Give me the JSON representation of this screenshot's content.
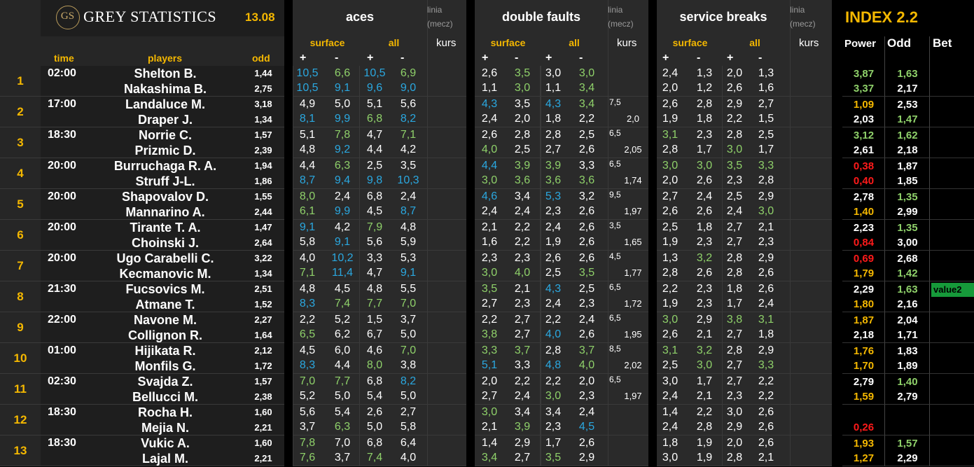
{
  "brand": {
    "logo_mono": "GS",
    "name": "GREY STATISTICS",
    "date": "13.08"
  },
  "headers": {
    "aces": "aces",
    "double_faults": "double faults",
    "service_breaks": "service breaks",
    "linia": "linia",
    "mecz": "(mecz)",
    "kurs": "kurs",
    "surface": "surface",
    "all": "all",
    "plus": "+",
    "minus": "-",
    "time": "time",
    "players": "players",
    "odd": "odd",
    "index": "INDEX 2.2",
    "power": "Power",
    "odd2": "Odd",
    "bet": "Bet"
  },
  "colors": {
    "white": "#ffffff",
    "blue": "#2aa8e0",
    "green": "#8fd16a",
    "yellow": "#f5b800",
    "red": "#ff1a1a",
    "bet_bg": "#169a3a"
  },
  "matches": [
    {
      "num": "1",
      "time": "02:00",
      "p1": "Shelton B.",
      "p2": "Nakashima B.",
      "o1": "1,44",
      "o2": "2,75",
      "aces": [
        [
          "10,5",
          "b",
          "6,6",
          "g",
          "10,5",
          "b",
          "6,9",
          "g"
        ],
        [
          "10,5",
          "b",
          "9,1",
          "b",
          "9,6",
          "b",
          "9,0",
          "b"
        ]
      ],
      "df": [
        [
          "2,6",
          "w",
          "3,5",
          "g",
          "3,0",
          "w",
          "3,0",
          "g"
        ],
        [
          "1,1",
          "w",
          "3,0",
          "g",
          "1,1",
          "w",
          "3,4",
          "g"
        ]
      ],
      "kl": "",
      "kv": "",
      "sb": [
        [
          "2,4",
          "w",
          "1,3",
          "w",
          "2,0",
          "w",
          "1,3",
          "w"
        ],
        [
          "2,0",
          "w",
          "1,2",
          "w",
          "2,6",
          "w",
          "1,6",
          "w"
        ]
      ],
      "pw": [
        [
          "3,87",
          "g"
        ],
        [
          "3,37",
          "g"
        ]
      ],
      "io": [
        [
          "1,63",
          "g"
        ],
        [
          "2,17",
          "w"
        ]
      ],
      "bet": ""
    },
    {
      "num": "2",
      "time": "17:00",
      "p1": "Landaluce M.",
      "p2": "Draper J.",
      "o1": "3,18",
      "o2": "1,34",
      "aces": [
        [
          "4,9",
          "w",
          "5,0",
          "w",
          "5,1",
          "w",
          "5,6",
          "w"
        ],
        [
          "8,1",
          "b",
          "9,9",
          "b",
          "6,8",
          "g",
          "8,2",
          "b"
        ]
      ],
      "df": [
        [
          "4,3",
          "b",
          "3,5",
          "w",
          "4,3",
          "b",
          "3,4",
          "g"
        ],
        [
          "2,4",
          "w",
          "2,0",
          "w",
          "1,8",
          "w",
          "2,2",
          "w"
        ]
      ],
      "kl": "7,5",
      "kv": "2,0",
      "sb": [
        [
          "2,6",
          "w",
          "2,8",
          "w",
          "2,9",
          "w",
          "2,7",
          "w"
        ],
        [
          "1,9",
          "w",
          "1,8",
          "w",
          "2,2",
          "w",
          "1,5",
          "w"
        ]
      ],
      "pw": [
        [
          "1,09",
          "y"
        ],
        [
          "2,03",
          "w"
        ]
      ],
      "io": [
        [
          "2,53",
          "w"
        ],
        [
          "1,47",
          "g"
        ]
      ],
      "bet": ""
    },
    {
      "num": "3",
      "time": "18:30",
      "p1": "Norrie C.",
      "p2": "Prizmic D.",
      "o1": "1,57",
      "o2": "2,39",
      "aces": [
        [
          "5,1",
          "w",
          "7,8",
          "g",
          "4,7",
          "w",
          "7,1",
          "g"
        ],
        [
          "4,8",
          "w",
          "9,2",
          "b",
          "4,4",
          "w",
          "4,2",
          "w"
        ]
      ],
      "df": [
        [
          "2,6",
          "w",
          "2,8",
          "w",
          "2,8",
          "w",
          "2,5",
          "w"
        ],
        [
          "4,0",
          "g",
          "2,5",
          "w",
          "2,7",
          "w",
          "2,6",
          "w"
        ]
      ],
      "kl": "6,5",
      "kv": "2,05",
      "sb": [
        [
          "3,1",
          "g",
          "2,3",
          "w",
          "2,8",
          "w",
          "2,5",
          "w"
        ],
        [
          "2,8",
          "w",
          "1,7",
          "w",
          "3,0",
          "g",
          "1,7",
          "w"
        ]
      ],
      "pw": [
        [
          "3,12",
          "g"
        ],
        [
          "2,61",
          "w"
        ]
      ],
      "io": [
        [
          "1,62",
          "g"
        ],
        [
          "2,18",
          "w"
        ]
      ],
      "bet": ""
    },
    {
      "num": "4",
      "time": "20:00",
      "p1": "Burruchaga R. A.",
      "p2": "Struff J-L.",
      "o1": "1,94",
      "o2": "1,86",
      "aces": [
        [
          "4,4",
          "w",
          "6,3",
          "g",
          "2,5",
          "w",
          "3,5",
          "w"
        ],
        [
          "8,7",
          "b",
          "9,4",
          "b",
          "9,8",
          "b",
          "10,3",
          "b"
        ]
      ],
      "df": [
        [
          "4,4",
          "b",
          "3,9",
          "g",
          "3,9",
          "g",
          "3,3",
          "w"
        ],
        [
          "3,0",
          "g",
          "3,6",
          "g",
          "3,6",
          "g",
          "3,6",
          "g"
        ]
      ],
      "kl": "6,5",
      "kv": "1,74",
      "sb": [
        [
          "3,0",
          "g",
          "3,0",
          "g",
          "3,5",
          "g",
          "3,3",
          "g"
        ],
        [
          "2,0",
          "w",
          "2,6",
          "w",
          "2,3",
          "w",
          "2,8",
          "w"
        ]
      ],
      "pw": [
        [
          "0,38",
          "r"
        ],
        [
          "0,40",
          "r"
        ]
      ],
      "io": [
        [
          "1,87",
          "w"
        ],
        [
          "1,85",
          "w"
        ]
      ],
      "bet": ""
    },
    {
      "num": "5",
      "time": "20:00",
      "p1": "Shapovalov D.",
      "p2": "Mannarino A.",
      "o1": "1,55",
      "o2": "2,44",
      "aces": [
        [
          "8,0",
          "g",
          "2,4",
          "w",
          "6,8",
          "w",
          "2,4",
          "w"
        ],
        [
          "6,1",
          "g",
          "9,9",
          "b",
          "4,5",
          "w",
          "8,7",
          "b"
        ]
      ],
      "df": [
        [
          "4,6",
          "b",
          "3,4",
          "w",
          "5,3",
          "b",
          "3,2",
          "w"
        ],
        [
          "2,4",
          "w",
          "2,4",
          "w",
          "2,3",
          "w",
          "2,6",
          "w"
        ]
      ],
      "kl": "9,5",
      "kv": "1,97",
      "sb": [
        [
          "2,7",
          "w",
          "2,4",
          "w",
          "2,5",
          "w",
          "2,9",
          "w"
        ],
        [
          "2,6",
          "w",
          "2,6",
          "w",
          "2,4",
          "w",
          "3,0",
          "g"
        ]
      ],
      "pw": [
        [
          "2,78",
          "w"
        ],
        [
          "1,40",
          "y"
        ]
      ],
      "io": [
        [
          "1,35",
          "g"
        ],
        [
          "2,99",
          "w"
        ]
      ],
      "bet": ""
    },
    {
      "num": "6",
      "time": "20:00",
      "p1": "Tirante T. A.",
      "p2": "Choinski J.",
      "o1": "1,47",
      "o2": "2,64",
      "aces": [
        [
          "9,1",
          "b",
          "4,2",
          "w",
          "7,9",
          "g",
          "4,8",
          "w"
        ],
        [
          "5,8",
          "w",
          "9,1",
          "b",
          "5,6",
          "w",
          "5,9",
          "w"
        ]
      ],
      "df": [
        [
          "2,1",
          "w",
          "2,2",
          "w",
          "2,4",
          "w",
          "2,6",
          "w"
        ],
        [
          "1,6",
          "w",
          "2,2",
          "w",
          "1,9",
          "w",
          "2,6",
          "w"
        ]
      ],
      "kl": "3,5",
      "kv": "1,65",
      "sb": [
        [
          "2,5",
          "w",
          "1,8",
          "w",
          "2,7",
          "w",
          "2,1",
          "w"
        ],
        [
          "1,9",
          "w",
          "2,3",
          "w",
          "2,7",
          "w",
          "2,3",
          "w"
        ]
      ],
      "pw": [
        [
          "2,23",
          "w"
        ],
        [
          "0,84",
          "r"
        ]
      ],
      "io": [
        [
          "1,35",
          "g"
        ],
        [
          "3,00",
          "w"
        ]
      ],
      "bet": ""
    },
    {
      "num": "7",
      "time": "20:00",
      "p1": "Ugo Carabelli C.",
      "p2": "Kecmanovic M.",
      "o1": "3,22",
      "o2": "1,34",
      "aces": [
        [
          "4,0",
          "w",
          "10,2",
          "b",
          "3,3",
          "w",
          "5,3",
          "w"
        ],
        [
          "7,1",
          "g",
          "11,4",
          "b",
          "4,7",
          "w",
          "9,1",
          "b"
        ]
      ],
      "df": [
        [
          "2,3",
          "w",
          "2,3",
          "w",
          "2,6",
          "w",
          "2,6",
          "w"
        ],
        [
          "3,0",
          "g",
          "4,0",
          "g",
          "2,5",
          "w",
          "3,5",
          "g"
        ]
      ],
      "kl": "4,5",
      "kv": "1,77",
      "sb": [
        [
          "1,3",
          "w",
          "3,2",
          "g",
          "2,8",
          "w",
          "2,9",
          "w"
        ],
        [
          "2,8",
          "w",
          "2,6",
          "w",
          "2,8",
          "w",
          "2,6",
          "w"
        ]
      ],
      "pw": [
        [
          "0,69",
          "r"
        ],
        [
          "1,79",
          "y"
        ]
      ],
      "io": [
        [
          "2,68",
          "w"
        ],
        [
          "1,42",
          "g"
        ]
      ],
      "bet": ""
    },
    {
      "num": "8",
      "time": "21:30",
      "p1": "Fucsovics M.",
      "p2": "Atmane T.",
      "o1": "2,51",
      "o2": "1,52",
      "aces": [
        [
          "4,8",
          "w",
          "4,5",
          "w",
          "4,8",
          "w",
          "5,5",
          "w"
        ],
        [
          "8,3",
          "b",
          "7,4",
          "g",
          "7,7",
          "g",
          "7,0",
          "g"
        ]
      ],
      "df": [
        [
          "3,5",
          "g",
          "2,1",
          "w",
          "4,3",
          "b",
          "2,5",
          "w"
        ],
        [
          "2,7",
          "w",
          "2,3",
          "w",
          "2,4",
          "w",
          "2,3",
          "w"
        ]
      ],
      "kl": "6,5",
      "kv": "1,72",
      "sb": [
        [
          "2,2",
          "w",
          "2,3",
          "w",
          "1,8",
          "w",
          "2,6",
          "w"
        ],
        [
          "1,9",
          "w",
          "2,3",
          "w",
          "1,7",
          "w",
          "2,4",
          "w"
        ]
      ],
      "pw": [
        [
          "2,29",
          "w"
        ],
        [
          "1,80",
          "y"
        ]
      ],
      "io": [
        [
          "1,63",
          "g"
        ],
        [
          "2,16",
          "w"
        ]
      ],
      "bet": "value2"
    },
    {
      "num": "9",
      "time": "22:00",
      "p1": "Navone M.",
      "p2": "Collignon R.",
      "o1": "2,27",
      "o2": "1,64",
      "aces": [
        [
          "2,2",
          "w",
          "5,2",
          "w",
          "1,5",
          "w",
          "3,7",
          "w"
        ],
        [
          "6,5",
          "g",
          "6,2",
          "w",
          "6,7",
          "w",
          "5,0",
          "w"
        ]
      ],
      "df": [
        [
          "2,2",
          "w",
          "2,7",
          "w",
          "2,2",
          "w",
          "2,4",
          "w"
        ],
        [
          "3,8",
          "g",
          "2,7",
          "w",
          "4,0",
          "b",
          "2,6",
          "w"
        ]
      ],
      "kl": "6,5",
      "kv": "1,95",
      "sb": [
        [
          "3,0",
          "g",
          "2,9",
          "w",
          "3,8",
          "g",
          "3,1",
          "g"
        ],
        [
          "2,6",
          "w",
          "2,1",
          "w",
          "2,7",
          "w",
          "1,8",
          "w"
        ]
      ],
      "pw": [
        [
          "1,87",
          "y"
        ],
        [
          "2,18",
          "w"
        ]
      ],
      "io": [
        [
          "2,04",
          "w"
        ],
        [
          "1,71",
          "w"
        ]
      ],
      "bet": ""
    },
    {
      "num": "10",
      "time": "01:00",
      "p1": "Hijikata R.",
      "p2": "Monfils G.",
      "o1": "2,12",
      "o2": "1,72",
      "aces": [
        [
          "4,5",
          "w",
          "6,0",
          "w",
          "4,6",
          "w",
          "7,0",
          "g"
        ],
        [
          "8,3",
          "b",
          "4,4",
          "w",
          "8,0",
          "g",
          "3,8",
          "w"
        ]
      ],
      "df": [
        [
          "3,3",
          "g",
          "3,7",
          "g",
          "2,8",
          "w",
          "3,7",
          "g"
        ],
        [
          "5,1",
          "b",
          "3,3",
          "w",
          "4,8",
          "b",
          "4,0",
          "g"
        ]
      ],
      "kl": "8,5",
      "kv": "2,02",
      "sb": [
        [
          "3,1",
          "g",
          "3,2",
          "g",
          "2,8",
          "w",
          "2,9",
          "w"
        ],
        [
          "2,5",
          "w",
          "3,0",
          "g",
          "2,7",
          "w",
          "3,3",
          "g"
        ]
      ],
      "pw": [
        [
          "1,76",
          "y"
        ],
        [
          "1,70",
          "y"
        ]
      ],
      "io": [
        [
          "1,83",
          "w"
        ],
        [
          "1,89",
          "w"
        ]
      ],
      "bet": ""
    },
    {
      "num": "11",
      "time": "02:30",
      "p1": "Svajda Z.",
      "p2": "Bellucci M.",
      "o1": "1,57",
      "o2": "2,38",
      "aces": [
        [
          "7,0",
          "g",
          "7,7",
          "g",
          "6,8",
          "w",
          "8,2",
          "b"
        ],
        [
          "5,2",
          "w",
          "5,0",
          "w",
          "5,4",
          "w",
          "5,0",
          "w"
        ]
      ],
      "df": [
        [
          "2,0",
          "w",
          "2,2",
          "w",
          "2,2",
          "w",
          "2,0",
          "w"
        ],
        [
          "2,7",
          "w",
          "2,4",
          "w",
          "3,0",
          "g",
          "2,3",
          "w"
        ]
      ],
      "kl": "6,5",
      "kv": "1,97",
      "sb": [
        [
          "3,0",
          "w",
          "1,7",
          "w",
          "2,7",
          "w",
          "2,2",
          "w"
        ],
        [
          "2,4",
          "w",
          "2,1",
          "w",
          "2,3",
          "w",
          "2,2",
          "w"
        ]
      ],
      "pw": [
        [
          "2,79",
          "w"
        ],
        [
          "1,59",
          "y"
        ]
      ],
      "io": [
        [
          "1,40",
          "g"
        ],
        [
          "2,79",
          "w"
        ]
      ],
      "bet": ""
    },
    {
      "num": "12",
      "time": "18:30",
      "p1": "Rocha H.",
      "p2": "Mejia N.",
      "o1": "1,60",
      "o2": "2,21",
      "aces": [
        [
          "5,6",
          "w",
          "5,4",
          "w",
          "2,6",
          "w",
          "2,7",
          "w"
        ],
        [
          "3,7",
          "w",
          "6,3",
          "g",
          "5,0",
          "w",
          "5,8",
          "w"
        ]
      ],
      "df": [
        [
          "3,0",
          "g",
          "3,4",
          "w",
          "3,4",
          "w",
          "2,4",
          "w"
        ],
        [
          "2,1",
          "w",
          "3,9",
          "g",
          "2,3",
          "w",
          "4,5",
          "b"
        ]
      ],
      "kl": "",
      "kv": "",
      "sb": [
        [
          "1,4",
          "w",
          "2,2",
          "w",
          "3,0",
          "w",
          "2,6",
          "w"
        ],
        [
          "2,4",
          "w",
          "2,8",
          "w",
          "2,9",
          "w",
          "2,6",
          "w"
        ]
      ],
      "pw": [
        [
          "",
          ""
        ],
        [
          "0,26",
          "r"
        ]
      ],
      "io": [
        [
          "",
          ""
        ],
        [
          "",
          ""
        ]
      ],
      "bet": ""
    },
    {
      "num": "13",
      "time": "18:30",
      "p1": "Vukic A.",
      "p2": "Lajal M.",
      "o1": "1,60",
      "o2": "2,21",
      "aces": [
        [
          "7,8",
          "g",
          "7,0",
          "w",
          "6,8",
          "w",
          "6,4",
          "w"
        ],
        [
          "7,6",
          "g",
          "3,7",
          "w",
          "7,4",
          "g",
          "4,0",
          "w"
        ]
      ],
      "df": [
        [
          "1,4",
          "w",
          "2,9",
          "w",
          "1,7",
          "w",
          "2,6",
          "w"
        ],
        [
          "3,4",
          "g",
          "2,7",
          "w",
          "3,5",
          "g",
          "2,9",
          "w"
        ]
      ],
      "kl": "",
      "kv": "",
      "sb": [
        [
          "1,8",
          "w",
          "1,9",
          "w",
          "2,0",
          "w",
          "2,6",
          "w"
        ],
        [
          "3,0",
          "w",
          "1,9",
          "w",
          "2,8",
          "w",
          "2,1",
          "w"
        ]
      ],
      "pw": [
        [
          "1,93",
          "y"
        ],
        [
          "1,27",
          "y"
        ]
      ],
      "io": [
        [
          "1,57",
          "g"
        ],
        [
          "2,29",
          "w"
        ]
      ],
      "bet": ""
    }
  ]
}
